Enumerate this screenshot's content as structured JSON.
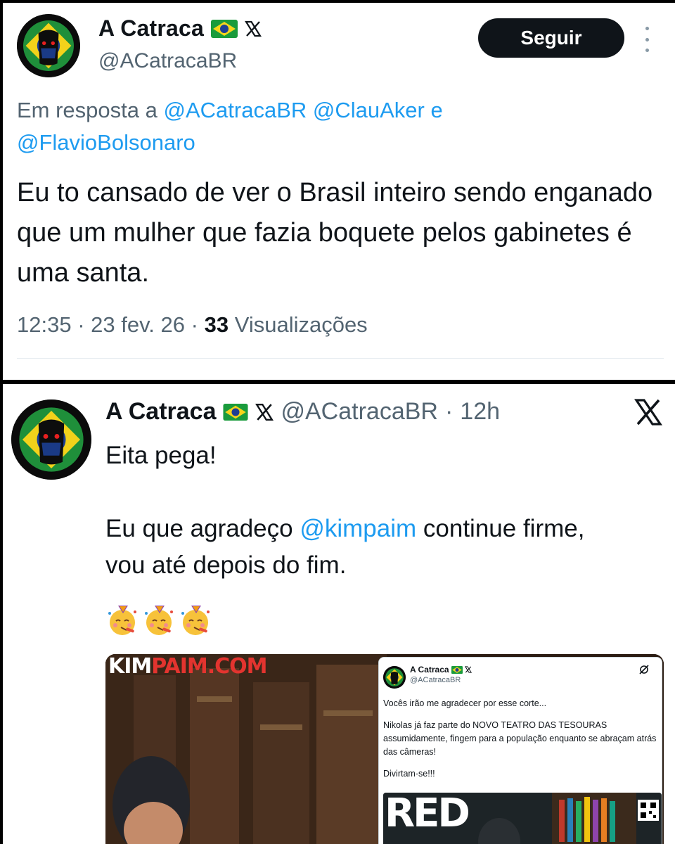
{
  "tweet1": {
    "author_name": "A Catraca",
    "author_handle": "@ACatracaBR",
    "follow_label": "Seguir",
    "reply_prefix": "Em resposta a",
    "reply_mention_1": "@ACatracaBR",
    "reply_mention_2": "@ClauAker",
    "reply_joiner": "e",
    "reply_mention_3": "@FlavioBolsonaro",
    "text": "Eu to cansado de ver o Brasil inteiro sendo enganado que um mulher que fazia boquete pelos gabinetes é uma santa.",
    "time": "12:35",
    "sep1": "·",
    "date": "23 fev. 26",
    "sep2": "·",
    "views_count": "33",
    "views_label": "Visualizações"
  },
  "tweet2": {
    "author_name": "A Catraca",
    "author_handle": "@ACatracaBR",
    "sep": "·",
    "time_ago": "12h",
    "line1": "Eita pega!",
    "line2_prefix": "Eu que agradeço",
    "line2_mention": "@kimpaim",
    "line2_suffix": "continue firme,\nvou até depois do fim.",
    "emoji_count": 3,
    "media": {
      "logo_white": "KIM",
      "logo_red": "PAIM.COM",
      "embedded_tweet": {
        "author_name": "A Catraca",
        "author_handle": "@ACatracaBR",
        "text_1": "Vocês irão me agradecer por esse corte...",
        "text_2": "Nikolas já faz parte do NOVO TEATRO DAS TESOURAS assumidamente, fingem para a população enquanto se abraçam atrás das câmeras!",
        "text_3": "Divirtam-se!!!",
        "video_label": "RED"
      }
    }
  },
  "colors": {
    "link": "#1d9bf0",
    "secondary_text": "#536471",
    "primary_text": "#0f1419",
    "button_bg": "#0f1419",
    "brand_red": "#e3342f"
  }
}
